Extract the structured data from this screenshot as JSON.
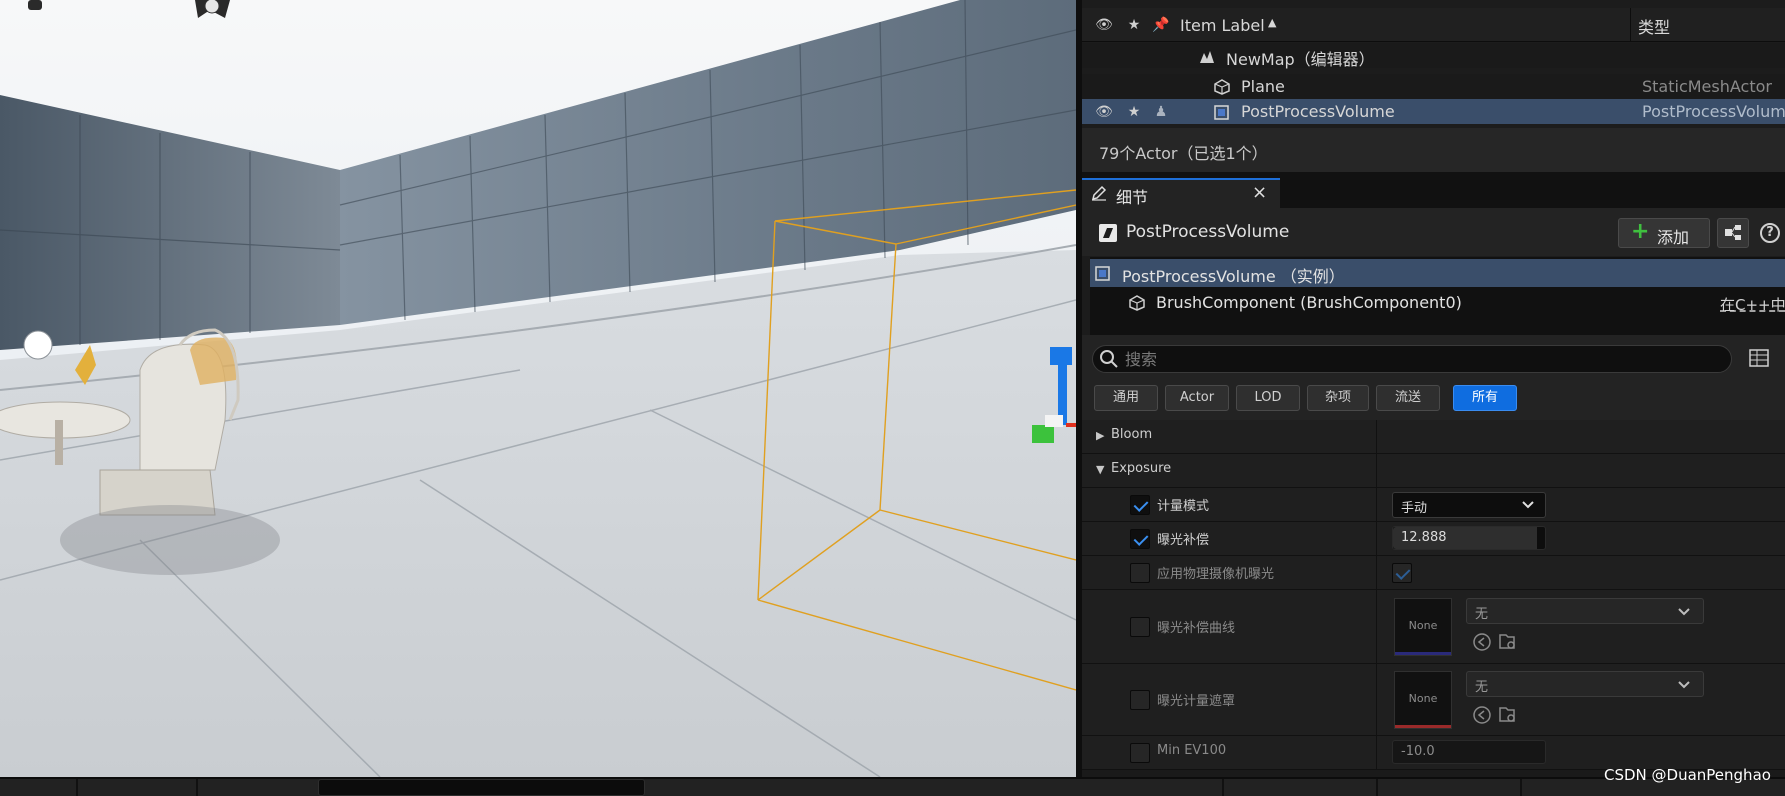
{
  "outliner": {
    "header": {
      "label": "Item Label",
      "sort_indicator": "▲",
      "type_column": "类型"
    },
    "rows": [
      {
        "label": "NewMap（编辑器）",
        "type": ""
      },
      {
        "label": "Plane",
        "type": "StaticMeshActor"
      },
      {
        "label": "PostProcessVolume",
        "type": "PostProcessVolum"
      }
    ],
    "footer": "79个Actor（已选1个）"
  },
  "details": {
    "tab_label": "细节",
    "tab_close": "×",
    "actor_title": "PostProcessVolume",
    "add_button": "添加",
    "help": "?",
    "components": [
      {
        "label": "PostProcessVolume （实例）",
        "link": ""
      },
      {
        "label": "BrushComponent (BrushComponent0)",
        "link": "在C++中"
      }
    ],
    "search_placeholder": "搜索",
    "filters": [
      "通用",
      "Actor",
      "LOD",
      "杂项",
      "流送",
      "所有"
    ],
    "active_filter": "所有",
    "properties": {
      "bloom": "Bloom",
      "exposure": "Exposure",
      "metering_mode": {
        "label": "计量模式",
        "value": "手动",
        "checked": true
      },
      "exposure_compensation": {
        "label": "曝光补偿",
        "value": "12.888",
        "checked": true
      },
      "apply_physical_camera": {
        "label": "应用物理摄像机曝光",
        "checked": true
      },
      "exposure_curve": {
        "label": "曝光补偿曲线",
        "thumb": "None",
        "asset": "无"
      },
      "metering_mask": {
        "label": "曝光计量遮罩",
        "thumb": "None",
        "asset": "无"
      },
      "min_ev100": {
        "label": "Min EV100",
        "value": "-10.0"
      }
    }
  },
  "watermark": "CSDN @DuanPenghao",
  "colors": {
    "selection": "#3a4e6a",
    "accent": "#0f6de0",
    "gizmo_blue": "#1a78e6",
    "volume_orange": "#e0a020"
  }
}
